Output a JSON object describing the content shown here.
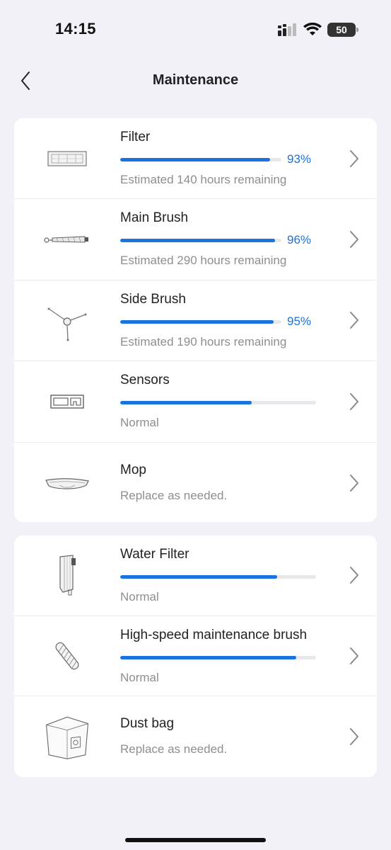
{
  "status": {
    "time": "14:15",
    "battery": "50"
  },
  "nav": {
    "title": "Maintenance"
  },
  "groups": [
    {
      "items": [
        {
          "title": "Filter",
          "subtitle": "Estimated 140 hours remaining",
          "progress": 93,
          "percent_label": "93%",
          "icon": "filter-icon"
        },
        {
          "title": "Main Brush",
          "subtitle": "Estimated 290 hours remaining",
          "progress": 96,
          "percent_label": "96%",
          "icon": "main-brush-icon"
        },
        {
          "title": "Side Brush",
          "subtitle": "Estimated 190 hours remaining",
          "progress": 95,
          "percent_label": "95%",
          "icon": "side-brush-icon"
        },
        {
          "title": "Sensors",
          "subtitle": "Normal",
          "progress": 67,
          "icon": "sensors-icon"
        },
        {
          "title": "Mop",
          "subtitle": "Replace as needed.",
          "icon": "mop-icon"
        }
      ]
    },
    {
      "items": [
        {
          "title": "Water Filter",
          "subtitle": "Normal",
          "progress": 80,
          "icon": "water-filter-icon"
        },
        {
          "title": "High-speed maintenance brush",
          "subtitle": "Normal",
          "progress": 90,
          "icon": "maintenance-brush-icon"
        },
        {
          "title": "Dust bag",
          "subtitle": "Replace as needed.",
          "icon": "dust-bag-icon"
        }
      ]
    }
  ],
  "colors": {
    "accent": "#1a73e0",
    "background": "#f2f1f7",
    "track": "#e8e8ec"
  }
}
